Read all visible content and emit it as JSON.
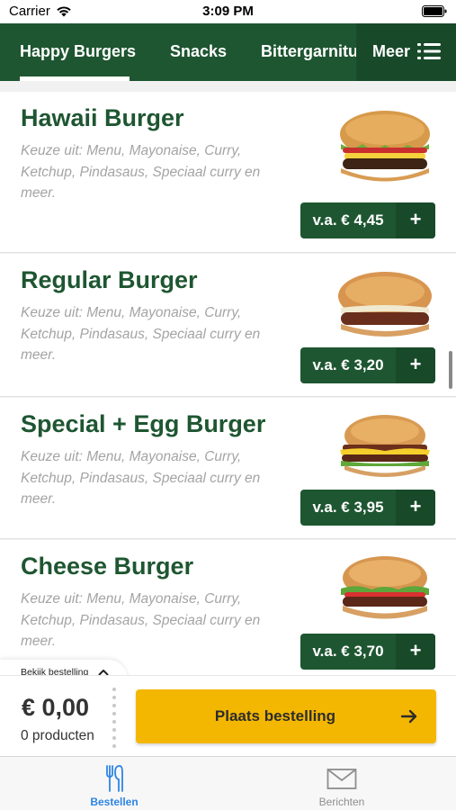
{
  "status_bar": {
    "carrier": "Carrier",
    "time": "3:09 PM"
  },
  "categories": {
    "tabs": [
      {
        "label": "Happy Burgers",
        "active": true
      },
      {
        "label": "Snacks",
        "active": false
      },
      {
        "label": "Bittergarnituur",
        "active": false
      }
    ],
    "more_label": "Meer",
    "accent_color": "#1e5631"
  },
  "products": [
    {
      "name": "Hawaii Burger",
      "description": "Keuze uit: Menu, Mayonaise, Curry, Ketchup, Pindasaus, Speciaal curry en meer.",
      "price": "v.a. € 4,45",
      "add_label": "+",
      "image": "hawaii-burger-image"
    },
    {
      "name": "Regular Burger",
      "description": "Keuze uit: Menu, Mayonaise, Curry, Ketchup, Pindasaus, Speciaal curry en meer.",
      "price": "v.a. € 3,20",
      "add_label": "+",
      "image": "regular-burger-image"
    },
    {
      "name": "Special + Egg Burger",
      "description": "Keuze uit: Menu, Mayonaise, Curry, Ketchup, Pindasaus, Speciaal curry en meer.",
      "price": "v.a. € 3,95",
      "add_label": "+",
      "image": "special-egg-burger-image"
    },
    {
      "name": "Cheese Burger",
      "description": "Keuze uit: Menu, Mayonaise, Curry, Ketchup, Pindasaus, Speciaal curry en meer.",
      "price": "v.a. € 3,70",
      "add_label": "+",
      "image": "cheese-burger-image"
    }
  ],
  "order": {
    "view_label": "Bekijk bestelling",
    "total": "€ 0,00",
    "count": "0 producten",
    "place_order_label": "Plaats bestelling",
    "button_color": "#f4b701"
  },
  "bottom_nav": {
    "items": [
      {
        "label": "Bestellen",
        "icon": "fork-knife-icon",
        "active": true
      },
      {
        "label": "Berichten",
        "icon": "envelope-icon",
        "active": false
      }
    ],
    "active_color": "#2d84e5"
  }
}
